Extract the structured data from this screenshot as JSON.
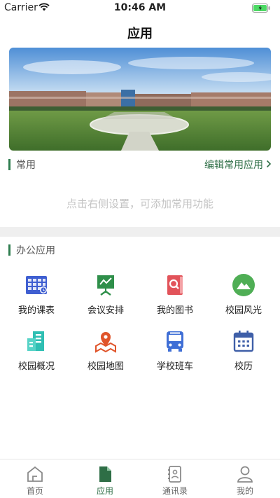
{
  "status_bar": {
    "carrier": "Carrier",
    "time": "10:46 AM"
  },
  "header": {
    "title": "应用"
  },
  "common_section": {
    "title": "常用",
    "edit_label": "编辑常用应用",
    "empty_hint": "点击右侧设置，可添加常用功能"
  },
  "office_section": {
    "title": "办公应用",
    "apps": [
      {
        "label": "我的课表",
        "icon": "timetable-icon"
      },
      {
        "label": "会议安排",
        "icon": "meeting-board-icon"
      },
      {
        "label": "我的图书",
        "icon": "book-search-icon"
      },
      {
        "label": "校园风光",
        "icon": "landscape-icon"
      },
      {
        "label": "校园概况",
        "icon": "building-icon"
      },
      {
        "label": "校园地图",
        "icon": "map-pin-icon"
      },
      {
        "label": "学校班车",
        "icon": "bus-icon"
      },
      {
        "label": "校历",
        "icon": "calendar-icon"
      }
    ]
  },
  "tab_bar": {
    "tabs": [
      {
        "label": "首页",
        "icon": "home-icon"
      },
      {
        "label": "应用",
        "icon": "document-icon"
      },
      {
        "label": "通讯录",
        "icon": "contacts-icon"
      },
      {
        "label": "我的",
        "icon": "user-icon"
      }
    ],
    "active_index": 1
  },
  "colors": {
    "accent": "#2e6e46",
    "section_bar": "#2e7d4f",
    "hint": "#c4c4c4"
  }
}
